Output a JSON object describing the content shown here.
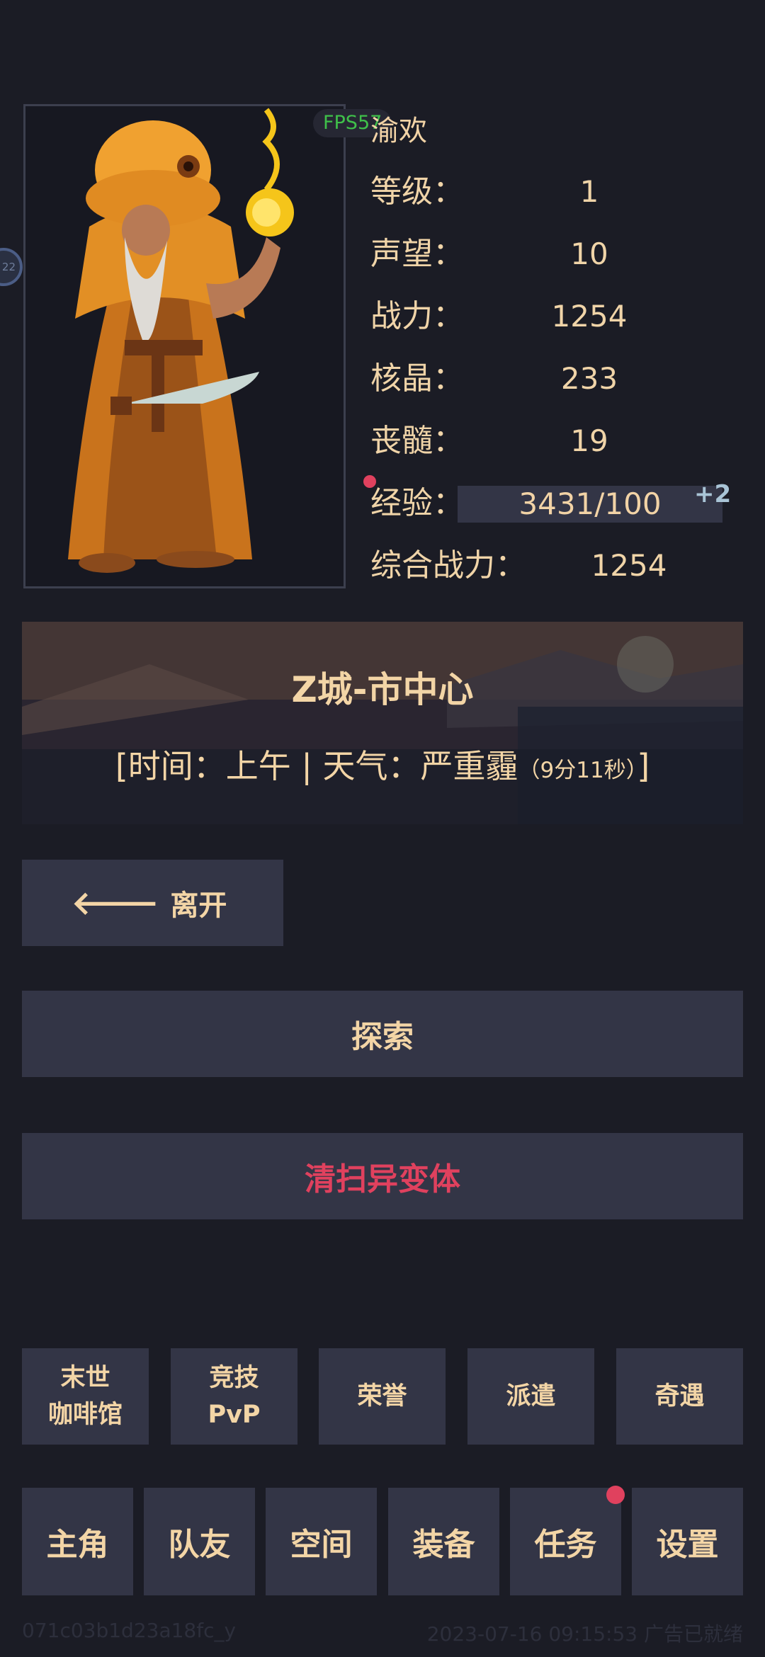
{
  "hud": {
    "fps": "FPS57",
    "side_orb": "22"
  },
  "character": {
    "name": "渝欢",
    "stats": [
      {
        "label": "等级：",
        "value": "1"
      },
      {
        "label": "声望：",
        "value": "10"
      },
      {
        "label": "战力：",
        "value": "1254"
      },
      {
        "label": "核晶：",
        "value": "233"
      },
      {
        "label": "丧髓：",
        "value": "19"
      }
    ],
    "exp_label": "经验：",
    "exp_value": "3431/100",
    "exp_bonus": "+2",
    "total_label": "综合战力：",
    "total_value": "1254"
  },
  "location": {
    "name": "Z城-市中心",
    "info_prefix": "[时间：上午 | 天气：严重霾",
    "info_timer": "（9分11秒）",
    "info_suffix": "]"
  },
  "actions": {
    "leave": "离开",
    "explore": "探索",
    "clear": "清扫异变体"
  },
  "features": [
    {
      "line1": "末世",
      "line2": "咖啡馆"
    },
    {
      "line1": "竞技",
      "line2": "PvP"
    },
    {
      "line1": "荣誉",
      "line2": ""
    },
    {
      "line1": "派遣",
      "line2": ""
    },
    {
      "line1": "奇遇",
      "line2": ""
    }
  ],
  "nav": [
    "主角",
    "队友",
    "空间",
    "装备",
    "任务",
    "设置"
  ],
  "footer": {
    "left": "071c03b1d23a18fc_y",
    "right": "2023-07-16 09:15:53 广告已就绪"
  },
  "colors": {
    "accent": "#f3d5a6",
    "danger": "#e0415e",
    "panel": "#333546",
    "background": "#1b1c25"
  }
}
